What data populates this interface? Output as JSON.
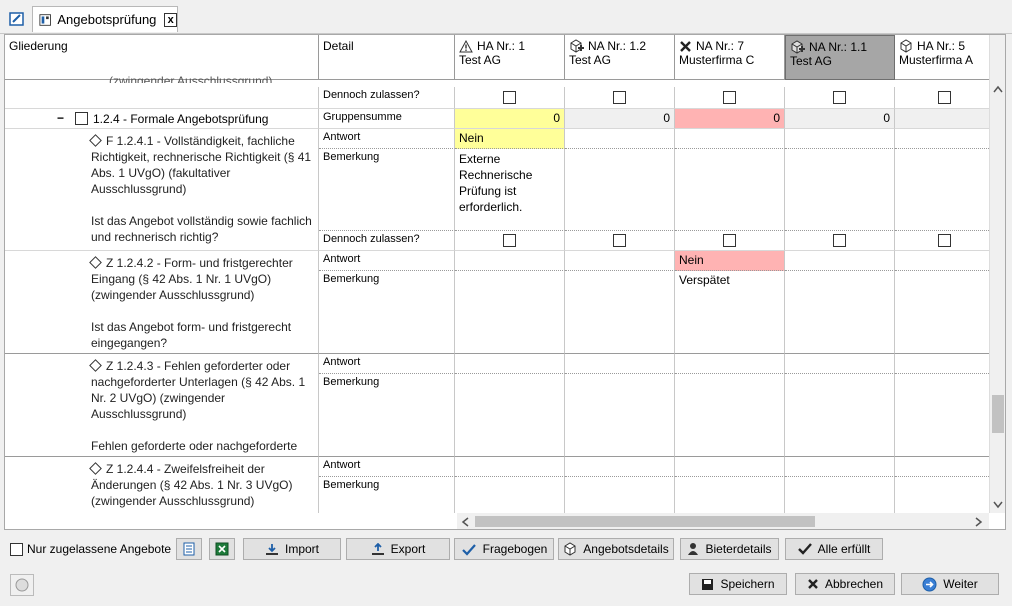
{
  "tab": {
    "title": "Angebotsprüfung",
    "close": "x"
  },
  "header": {
    "col_gliederung": "Gliederung",
    "col_detail": "Detail",
    "offers": [
      {
        "nr": "HA Nr.: 1",
        "name": "Test AG",
        "icon": "warning-icon"
      },
      {
        "nr": "NA Nr.: 1.2",
        "name": "Test AG",
        "icon": "package-plus-icon"
      },
      {
        "nr": "NA Nr.: 7",
        "name": "Musterfirma C",
        "icon": "x-icon"
      },
      {
        "nr": "NA Nr.: 1.1",
        "name": "Test AG",
        "icon": "package-plus-icon",
        "selected": true
      },
      {
        "nr": "HA Nr.: 5",
        "name": "Musterfirma A",
        "icon": "package-icon"
      }
    ]
  },
  "rows": {
    "top_fragment": "(zwingender Ausschlussgrund)",
    "dennoch": "Dennoch zulassen?",
    "group_label": "1.2.4 - Formale Angebotsprüfung",
    "gruppensumme": "Gruppensumme",
    "sums": [
      "0",
      "0",
      "0",
      "0"
    ],
    "antwort": "Antwort",
    "bemerkung": "Bemerkung",
    "f1241_title": "F 1.2.4.1 - Vollständigkeit, fachliche Richtigkeit, rechnerische Richtigkeit (§ 41 Abs. 1 UVgO) (fakultativer Ausschlussgrund)",
    "f1241_question": "Ist das Angebot vollständig sowie fachlich und rechnerisch richtig?",
    "f1241_answer": "Nein",
    "f1241_remark": "Externe Rechnerische Prüfung ist erforderlich.",
    "z1242_title": "Z 1.2.4.2 - Form- und fristgerechter Eingang (§ 42 Abs. 1 Nr. 1 UVgO) (zwingender Ausschlussgrund)",
    "z1242_question": "Ist das Angebot form- und fristgerecht eingegangen?",
    "z1242_answer": "Nein",
    "z1242_remark": "Verspätet",
    "z1243_title": "Z 1.2.4.3 - Fehlen geforderter oder nachgeforderter Unterlagen (§ 42 Abs. 1 Nr. 2 UVgO) (zwingender Ausschlussgrund)",
    "z1243_question": "Fehlen geforderte oder nachgeforderte",
    "z1244_title": "Z 1.2.4.4 - Zweifelsfreiheit der Änderungen (§ 42 Abs. 1 Nr. 3 UVgO) (zwingender Ausschlussgrund)"
  },
  "toolbar": {
    "only_admitted": "Nur zugelassene Angebote",
    "import": "Import",
    "export": "Export",
    "fragebogen": "Fragebogen",
    "angebotsdetails": "Angebotsdetails",
    "bieterdetails": "Bieterdetails",
    "alle_erfuellt": "Alle erfüllt"
  },
  "footer": {
    "save": "Speichern",
    "cancel": "Abbrechen",
    "next": "Weiter"
  },
  "colors": {
    "yellow": "#ffff99",
    "pink": "#ffb3b3",
    "selected_header": "#a6a6a6"
  }
}
